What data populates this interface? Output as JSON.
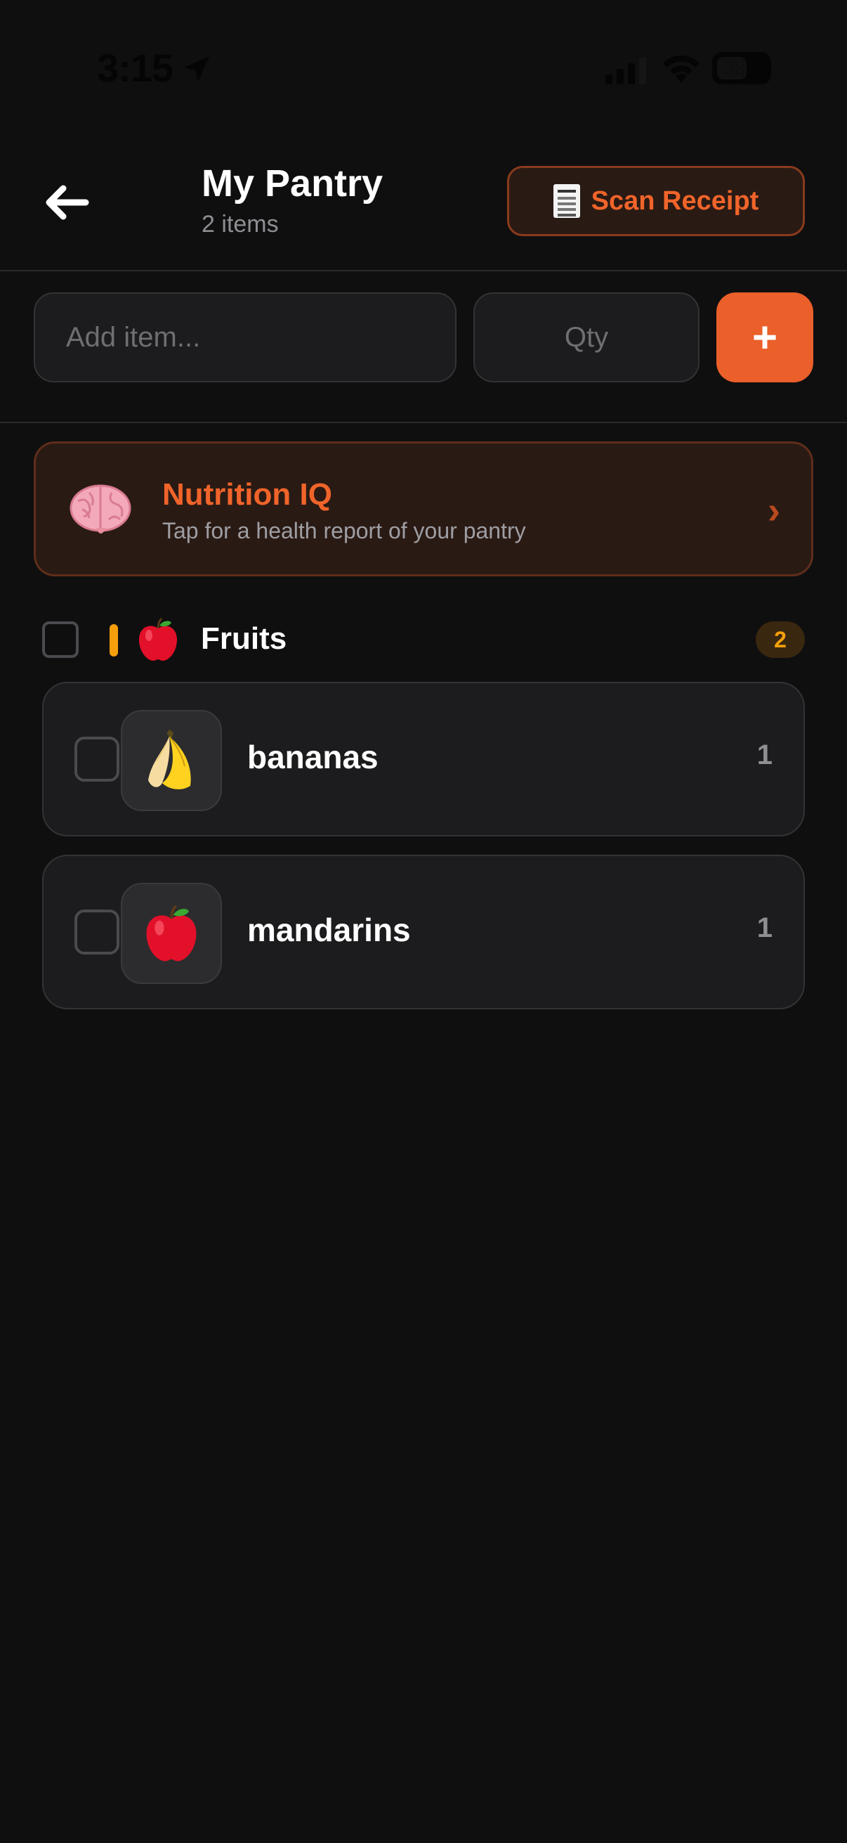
{
  "status_bar": {
    "time": "3:15",
    "battery": "58"
  },
  "header": {
    "title": "My Pantry",
    "subtitle": "2 items",
    "scan_button": "Scan Receipt"
  },
  "add_row": {
    "item_placeholder": "Add item...",
    "qty_placeholder": "Qty",
    "add_button": "+"
  },
  "nutrition": {
    "title": "Nutrition IQ",
    "subtitle": "Tap for a health report of your pantry",
    "chevron": "›"
  },
  "category": {
    "label": "Fruits",
    "count": "2",
    "accent_color": "#f5a00a"
  },
  "items": [
    {
      "name": "bananas",
      "qty": "1",
      "icon": "banana-icon"
    },
    {
      "name": "mandarins",
      "qty": "1",
      "icon": "apple-icon"
    }
  ],
  "colors": {
    "background": "#0f0f0f",
    "accent": "#ea5f2a",
    "card": "#1c1c1e"
  }
}
